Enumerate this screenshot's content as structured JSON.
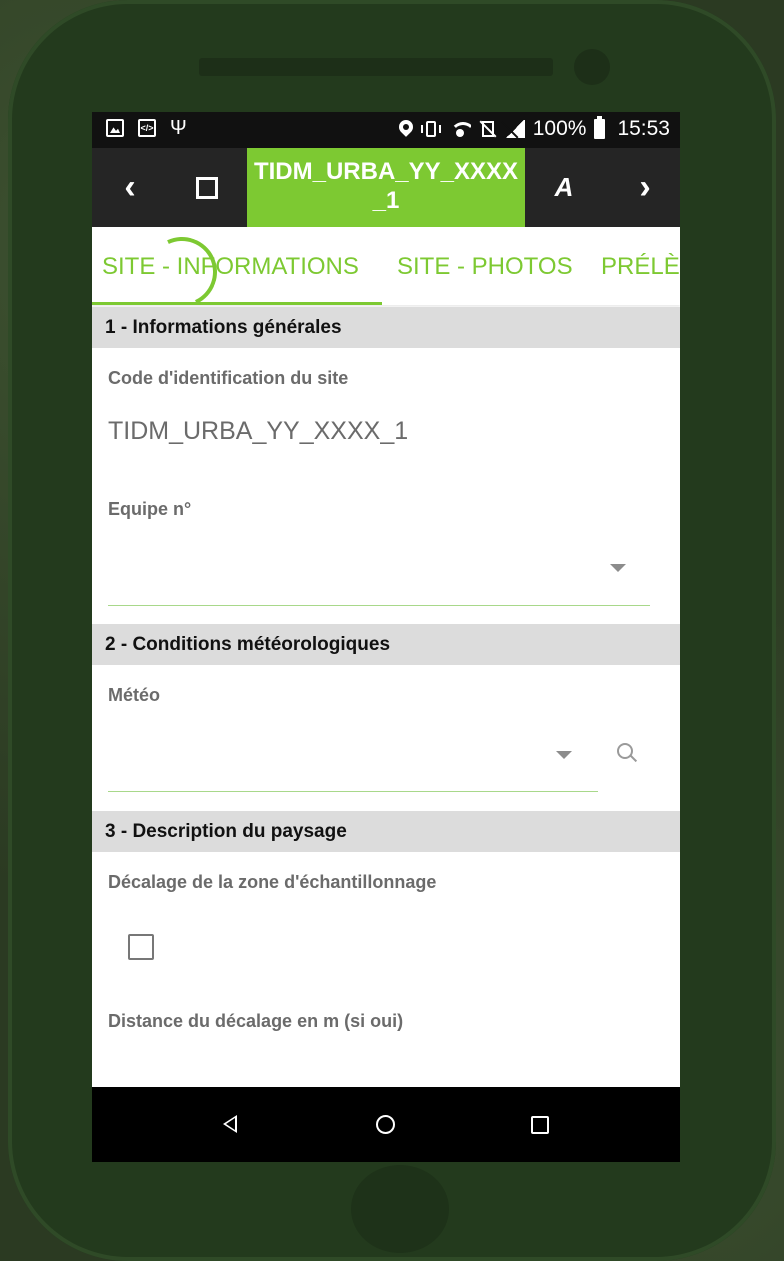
{
  "status_bar": {
    "battery": "100%",
    "time": "15:53",
    "icons": [
      "image-icon",
      "code-icon",
      "usb-icon",
      "location-icon",
      "vibrate-icon",
      "wifi-icon",
      "no-sim-icon",
      "signal-icon",
      "battery-icon"
    ]
  },
  "toolbar": {
    "back_icon": "‹",
    "fullscreen_icon": "fullscreen-icon",
    "title_line1": "TIDM_URBA_YY_XXXX",
    "title_line2": "_1",
    "edit_icon": "A",
    "next_icon": "›"
  },
  "tabs": [
    {
      "label": "SITE - INFORMATIONS",
      "active": true
    },
    {
      "label": "SITE - PHOTOS",
      "active": false
    },
    {
      "label": "PRÉLÈ",
      "active": false
    }
  ],
  "sections": {
    "s1": {
      "title": "1 - Informations générales",
      "code_label": "Code d'identification du site",
      "code_value": "TIDM_URBA_YY_XXXX_1",
      "equipe_label": "Equipe n°",
      "equipe_value": ""
    },
    "s2": {
      "title": "2 - Conditions météorologiques",
      "meteo_label": "Météo",
      "meteo_value": ""
    },
    "s3": {
      "title": "3 - Description du paysage",
      "decalage_label": "Décalage de la zone d'échantillonnage",
      "decalage_checked": false,
      "distance_label": "Distance du décalage en m (si oui)"
    }
  },
  "colors": {
    "accent": "#7dc932",
    "toolbar": "#252525",
    "section_header": "#dcdcdc",
    "phone_body": "#233a1d"
  }
}
